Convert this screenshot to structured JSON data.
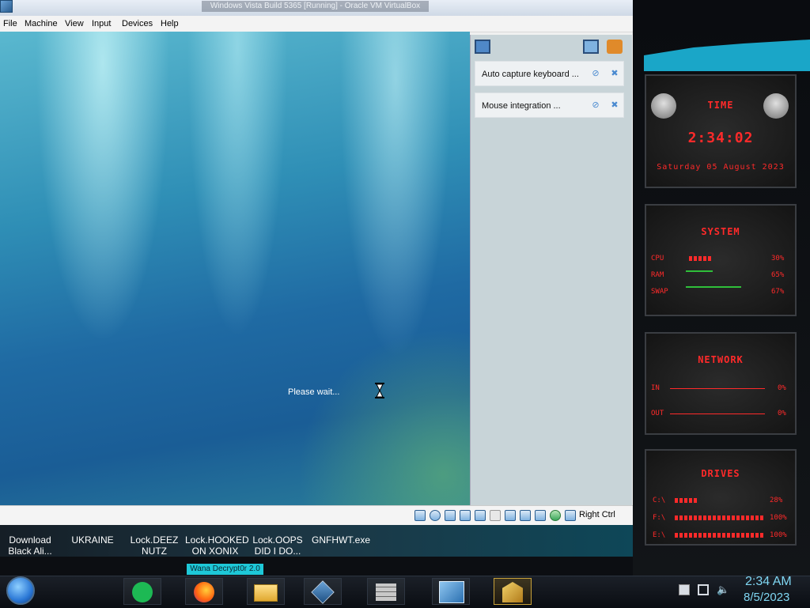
{
  "window": {
    "title": "Windows Vista Build 5365 [Running] - Oracle VM VirtualBox",
    "menu": [
      "File",
      "Machine",
      "View",
      "Input",
      "Devices",
      "Help"
    ]
  },
  "guest": {
    "status_text": "Please wait...",
    "notifications": [
      {
        "text": "Auto capture keyboard ..."
      },
      {
        "text": "Mouse integration ..."
      }
    ]
  },
  "statusbar": {
    "host_key_label": "Right Ctrl"
  },
  "desktop_icons": [
    {
      "label_line1": "Download",
      "label_line2": "Black Ali..."
    },
    {
      "label_line1": "UKRAINE",
      "label_line2": ""
    },
    {
      "label_line1": "Lock.DEEZ",
      "label_line2": "NUTZ"
    },
    {
      "label_line1": "Lock.HOOKED",
      "label_line2": "ON XONIX"
    },
    {
      "label_line1": "Lock.OOPS",
      "label_line2": "DID I DO..."
    },
    {
      "label_line1": "GNFHWT.exe",
      "label_line2": ""
    }
  ],
  "tooltip": "Wana Decrypt0r 2.0",
  "widget": {
    "time": {
      "title": "TIME",
      "clock": "2:34:02",
      "date": "Saturday 05 August 2023"
    },
    "system": {
      "title": "SYSTEM",
      "rows": [
        {
          "label": "CPU",
          "value": "30%"
        },
        {
          "label": "RAM",
          "value": "65%"
        },
        {
          "label": "SWAP",
          "value": "67%"
        }
      ]
    },
    "network": {
      "title": "NETWORK",
      "rows": [
        {
          "label": "IN",
          "value": "0%"
        },
        {
          "label": "OUT",
          "value": "0%"
        }
      ]
    },
    "drives": {
      "title": "DRIVES",
      "rows": [
        {
          "label": "C:\\",
          "value": "28%"
        },
        {
          "label": "F:\\",
          "value": "100%"
        },
        {
          "label": "E:\\",
          "value": "100%"
        }
      ]
    }
  },
  "taskbar": {
    "apps": [
      "spotify-icon",
      "firefox-icon",
      "file-explorer-icon",
      "virtualbox-icon",
      "firewall-icon",
      "vista-icon",
      "wana-decryptor-icon"
    ],
    "clock_time": "2:34 AM",
    "clock_date": "8/5/2023"
  },
  "colors": {
    "accent_red": "#ff2a2a",
    "accent_cyan": "#1aa6c8",
    "clock_text": "#7fd6f2"
  }
}
